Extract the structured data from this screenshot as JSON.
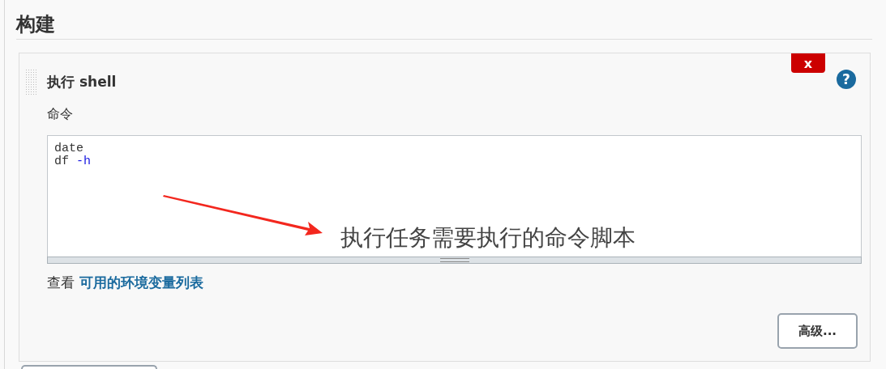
{
  "section": {
    "title": "构建"
  },
  "step": {
    "title": "执行 shell",
    "delete_label": "x",
    "help_label": "?",
    "command": {
      "label": "命令",
      "lines": [
        [
          {
            "kind": "plain",
            "text": "date"
          }
        ],
        [
          {
            "kind": "plain",
            "text": "df "
          },
          {
            "kind": "option",
            "text": "-h"
          }
        ]
      ]
    },
    "env_hint": {
      "prefix": "查看",
      "link": "可用的环境变量列表"
    },
    "advanced_button": "高级..."
  },
  "annotation": {
    "text": "执行任务需要执行的命令脚本"
  }
}
